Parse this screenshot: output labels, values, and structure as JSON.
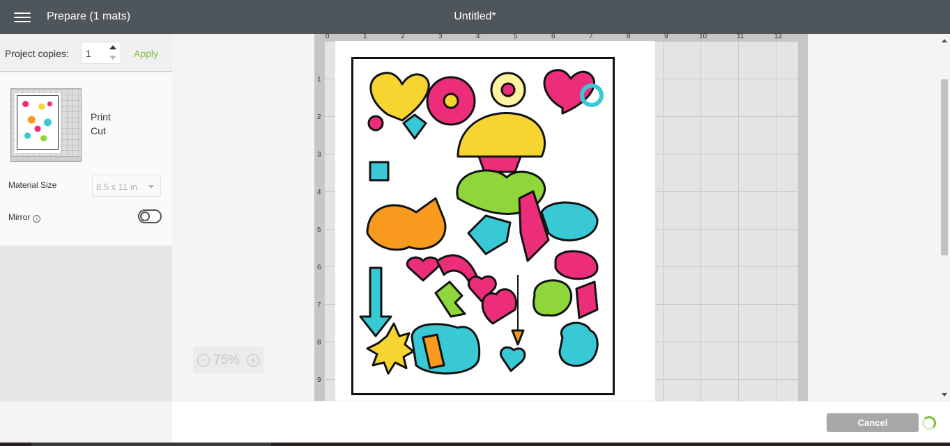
{
  "header": {
    "prepare_title": "Prepare (1 mats)",
    "document_title": "Untitled*"
  },
  "left_panel": {
    "copies_label": "Project copies:",
    "copies_value": "1",
    "apply_label": "Apply",
    "mat_operation_line1": "Print",
    "mat_operation_line2": "Cut",
    "material_size_label": "Material Size",
    "material_size_value": "8.5 x 11 in.",
    "mirror_label": "Mirror",
    "mirror_info": "i",
    "mirror_on": false
  },
  "canvas": {
    "ruler_top": [
      "0",
      "1",
      "2",
      "3",
      "4",
      "5",
      "6",
      "7",
      "8",
      "9",
      "10",
      "11",
      "12"
    ],
    "ruler_left": [
      "1",
      "2",
      "3",
      "4",
      "5",
      "6",
      "7",
      "8",
      "9"
    ],
    "zoom_minus": "−",
    "zoom_value": "75%",
    "zoom_plus": "+"
  },
  "footer": {
    "cancel_label": "Cancel"
  },
  "colors": {
    "header_bg": "#4e565c",
    "accent_green": "#7bbf42",
    "cancel_bg": "#a8a8a8",
    "pink": "#ec2d7a",
    "yellow": "#f6d531",
    "orange": "#f79a1e",
    "teal": "#39c9d4",
    "lime": "#8ed63a"
  }
}
